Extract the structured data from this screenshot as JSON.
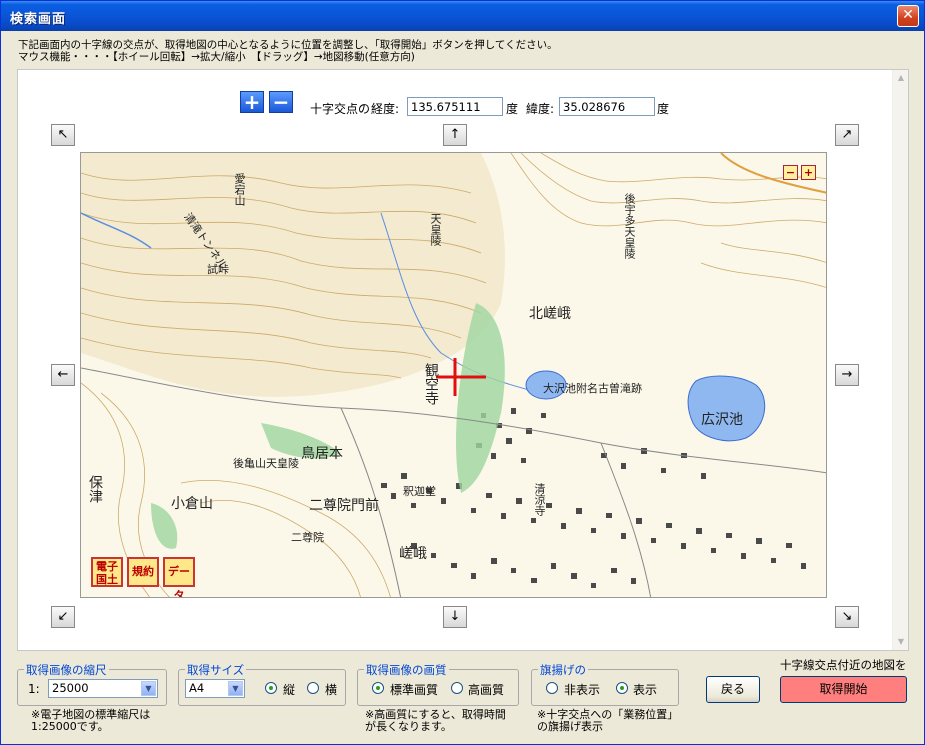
{
  "window": {
    "title": "検索画面",
    "close": "✕"
  },
  "instructions": {
    "line1": "下記画面内の十字線の交点が、取得地図の中心となるように位置を調整し、「取得開始」ボタンを押してください。",
    "line2": "マウス機能・・・・【ホイール回転】→拡大/縮小　【ドラッグ】→地図移動(任意方向)"
  },
  "zoom": {
    "plus": "+",
    "minus": "−"
  },
  "coords": {
    "label": "十字交点の",
    "lon_label": "経度:",
    "lon_value": "135.675111",
    "lon_unit": "度",
    "lat_label": "緯度:",
    "lat_value": "35.028676",
    "lat_unit": "度"
  },
  "map": {
    "zoom_minus": "−",
    "zoom_plus": "+",
    "badges": [
      "電子国土",
      "規約",
      "データ"
    ],
    "labels": [
      "北嵯峨",
      "大沢池附名古曽滝跡",
      "広沢池",
      "観空寺",
      "鳥居本",
      "二尊院門前",
      "小倉山",
      "保津",
      "後宇多天皇陵",
      "嵯峨",
      "釈迦堂",
      "清涼寺",
      "後亀山天皇陵",
      "試峠",
      "二尊院",
      "天皇陵",
      "清滝トンネル",
      "愛宕山"
    ]
  },
  "scale": {
    "title": "取得画像の縮尺",
    "prefix": "1:",
    "value": "25000",
    "note1": "※電子地図の標準縮尺は",
    "note2": "1:25000です。"
  },
  "size": {
    "title": "取得サイズ",
    "value": "A4",
    "portrait": "縦",
    "landscape": "横"
  },
  "quality": {
    "title": "取得画像の画質",
    "standard": "標準画質",
    "high": "高画質",
    "note1": "※高画質にすると、取得時間",
    "note2": "が長くなります。"
  },
  "flag": {
    "title": "旗揚げの",
    "hide": "非表示",
    "show": "表示",
    "note1": "※十字交点への「業務位置」",
    "note2": "の旗揚げ表示"
  },
  "actions": {
    "caption": "十字線交点付近の地図を",
    "back": "戻る",
    "start": "取得開始"
  },
  "colors": {
    "title_bar": "#0a55d6",
    "start_button": "#ff7f7f",
    "group_title": "#0046d5",
    "crosshair": "#e01010"
  }
}
